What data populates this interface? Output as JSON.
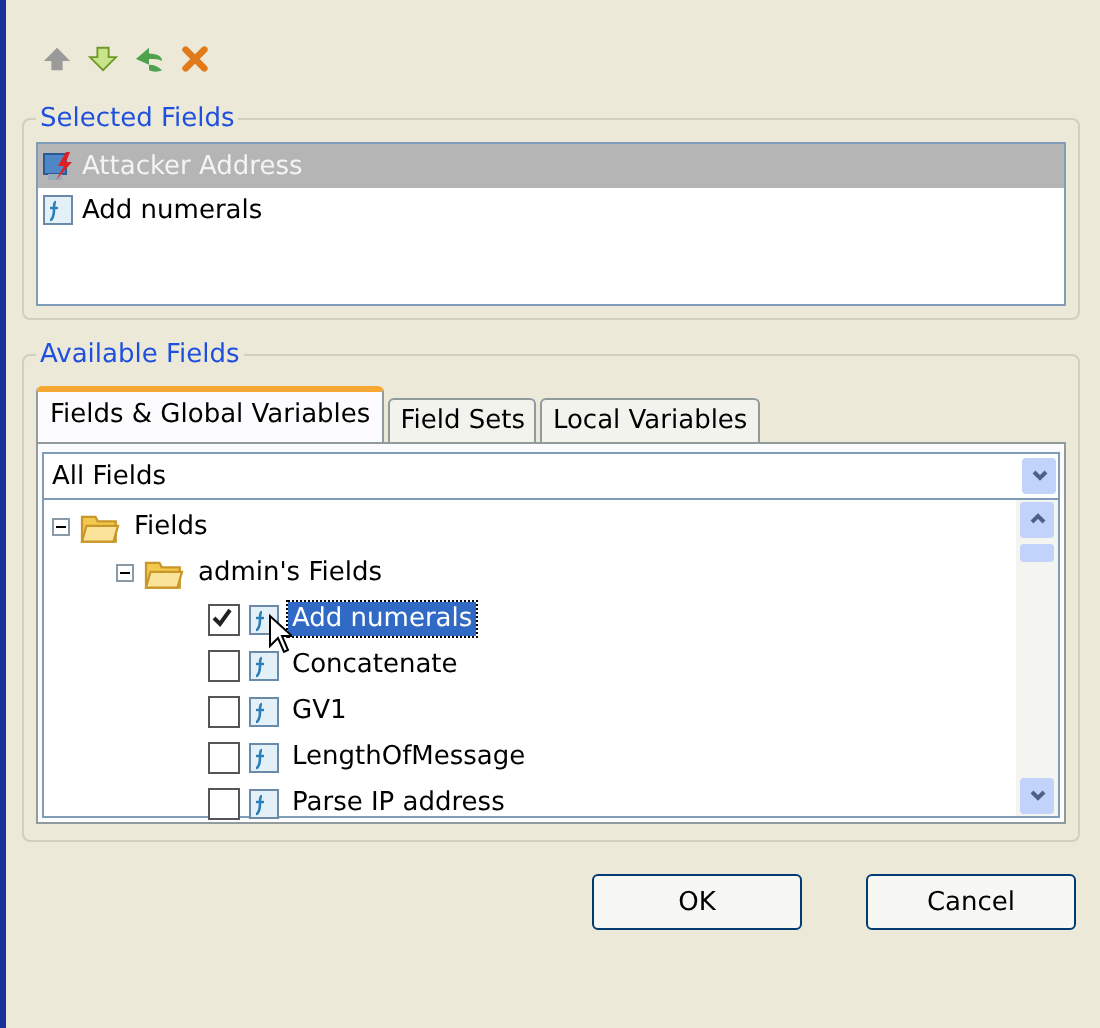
{
  "selected_fields": {
    "title": "Selected Fields",
    "items": [
      {
        "label": "Attacker Address",
        "kind": "event",
        "selected": true
      },
      {
        "label": "Add numerals",
        "kind": "function",
        "selected": false
      }
    ]
  },
  "available_fields": {
    "title": "Available Fields",
    "tabs": [
      {
        "label": "Fields & Global Variables",
        "selected": true
      },
      {
        "label": "Field Sets",
        "selected": false
      },
      {
        "label": "Local Variables",
        "selected": false
      }
    ],
    "filter": {
      "value": "All Fields"
    },
    "tree": [
      {
        "label": "Fields",
        "expanded": true,
        "children": [
          {
            "label": "admin's Fields",
            "expanded": true,
            "children": [
              {
                "label": "Add numerals",
                "checked": true,
                "selected": true
              },
              {
                "label": "Concatenate",
                "checked": false,
                "selected": false
              },
              {
                "label": "GV1",
                "checked": false,
                "selected": false
              },
              {
                "label": "LengthOfMessage",
                "checked": false,
                "selected": false
              },
              {
                "label": "Parse IP address",
                "checked": false,
                "selected": false
              }
            ]
          }
        ]
      }
    ]
  },
  "buttons": [
    {
      "label": "OK"
    },
    {
      "label": "Cancel"
    }
  ]
}
